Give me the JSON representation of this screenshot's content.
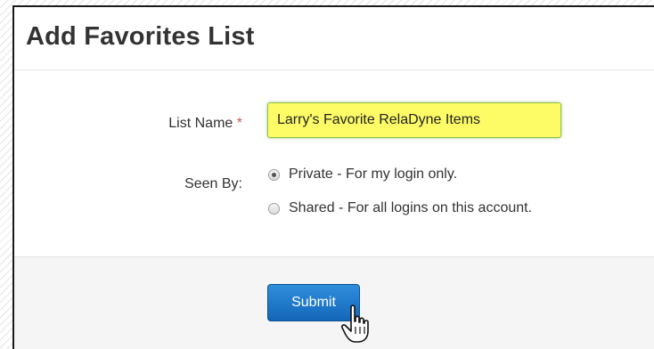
{
  "dialog": {
    "title": "Add Favorites List"
  },
  "form": {
    "list_name_label": "List Name",
    "required_marker": "*",
    "list_name_value": "Larry's Favorite RelaDyne Items",
    "seen_by_label": "Seen By:",
    "options": [
      {
        "label": "Private - For my login only.",
        "checked": true
      },
      {
        "label": "Shared - For all logins on this account.",
        "checked": false
      }
    ]
  },
  "footer": {
    "submit_label": "Submit"
  },
  "colors": {
    "input_highlight": "#fefc66",
    "button": "#1a74c9"
  },
  "icons": [
    "hand-pointer-cursor-icon"
  ]
}
